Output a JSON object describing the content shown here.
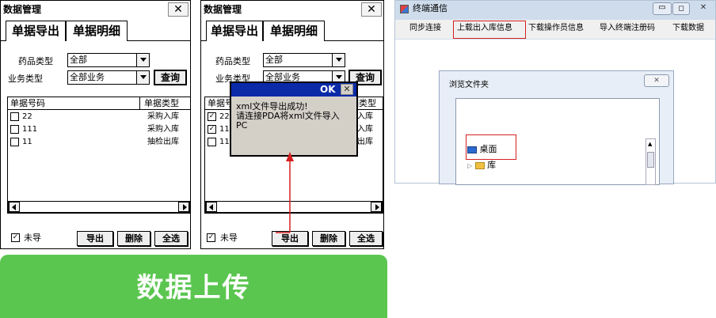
{
  "panel1": {
    "title": "数据管理",
    "close": "✕",
    "tabs": [
      "单据导出",
      "单据明细"
    ],
    "drug_type_label": "药品类型",
    "drug_type_value": "全部",
    "biz_type_label": "业务类型",
    "biz_type_value": "全部业务",
    "query_button": "查询",
    "columns": [
      "单据号码",
      "单据类型"
    ],
    "rows": [
      {
        "code": "22",
        "type": "采购入库",
        "checked": false
      },
      {
        "code": "111",
        "type": "采购入库",
        "checked": false
      },
      {
        "code": "11",
        "type": "抽检出库",
        "checked": false
      }
    ],
    "unexported_label": "未导",
    "unexported_checked": true,
    "export_button": "导出",
    "delete_button": "删除",
    "select_all_button": "全选"
  },
  "panel2": {
    "title": "数据管理",
    "close": "✕",
    "tabs": [
      "单据导出",
      "单据明细"
    ],
    "drug_type_label": "药品类型",
    "drug_type_value": "全部",
    "biz_type_label": "业务类型",
    "biz_type_value": "全部业务",
    "query_button": "查询",
    "columns": [
      "单据号码",
      "单据类型"
    ],
    "rows": [
      {
        "code": "22",
        "type": "采购入库",
        "checked": true
      },
      {
        "code": "111",
        "type": "采购入库",
        "checked": true
      },
      {
        "code": "11",
        "type": "抽检出库",
        "checked": false
      }
    ],
    "unexported_label": "未导",
    "unexported_checked": true,
    "export_button": "导出",
    "delete_button": "删除",
    "select_all_button": "全选",
    "dialog": {
      "ok": "OK",
      "close": "✕",
      "message_line1": "xml文件导出成功!",
      "message_line2": "请连接PDA将xml文件导入",
      "message_line3": "PC"
    }
  },
  "desktop": {
    "title": "终端通信",
    "menu": [
      "同步连接",
      "上载出入库信息",
      "下载操作员信息",
      "导入终端注册码",
      "下载数据"
    ],
    "browse_title": "浏览文件夹",
    "browse_close": "✕",
    "tree_items": [
      "桌面",
      "库"
    ]
  },
  "banner": {
    "text": "数据上传"
  },
  "colors": {
    "accent_red": "#d42020",
    "banner_green": "#5ac64f",
    "dialog_blue": "#0a2aa8"
  }
}
